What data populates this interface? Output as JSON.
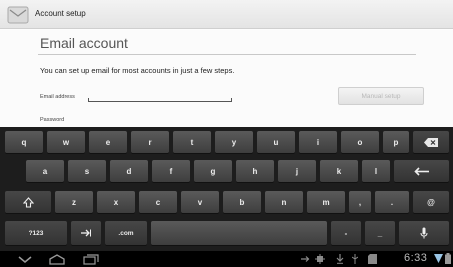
{
  "window": {
    "title": "Account setup"
  },
  "form": {
    "heading": "Email account",
    "intro": "You can set up email for most accounts in just a few steps.",
    "email_label": "Email address",
    "email_value": "",
    "password_label": "Password",
    "manual_setup_label": "Manual setup"
  },
  "keyboard": {
    "row1": [
      "q",
      "w",
      "e",
      "r",
      "t",
      "y",
      "u",
      "i",
      "o",
      "p"
    ],
    "row2": [
      "a",
      "s",
      "d",
      "f",
      "g",
      "h",
      "j",
      "k",
      "l"
    ],
    "row3": [
      "z",
      "x",
      "c",
      "v",
      "b",
      "n",
      "m",
      ",",
      "."
    ],
    "at_key": "@",
    "numbers_key": "?123",
    "com_key": ".com",
    "dash_key": "-",
    "underscore_key": "_",
    "icons": {
      "backspace": "backspace-icon",
      "enter": "enter-icon",
      "shift": "shift-icon",
      "tab": "tab-icon",
      "mic": "mic-icon"
    }
  },
  "status_bar": {
    "time": "6:33",
    "icons": [
      "usb-icon",
      "usb-debug-icon",
      "download-icon",
      "usb-storage-icon",
      "sd-card-icon",
      "wifi-icon",
      "battery-icon"
    ]
  },
  "nav_bar": {
    "icons": [
      "hide-keyboard-icon",
      "home-icon",
      "recent-apps-icon"
    ]
  }
}
